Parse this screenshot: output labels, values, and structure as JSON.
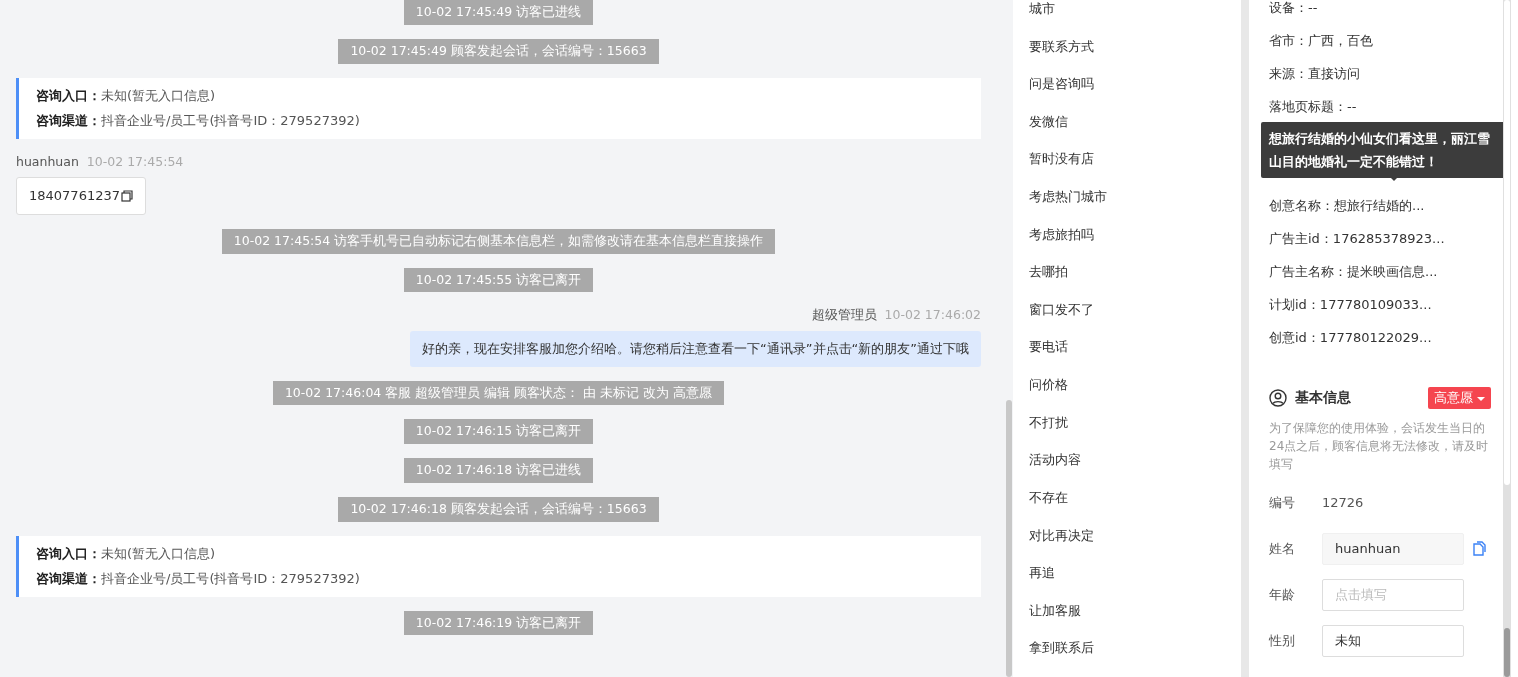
{
  "chat": [
    {
      "kind": "system",
      "text": "10-02 17:45:49 访客已进线"
    },
    {
      "kind": "system",
      "text": "10-02 17:45:49 顾客发起会话，会话编号：15663"
    },
    {
      "kind": "source",
      "lines": [
        {
          "label": "咨询入口：",
          "value": "未知(暂无入口信息)"
        },
        {
          "label": "咨询渠道：",
          "value": "抖音企业号/员工号(抖音号ID：279527392)"
        }
      ]
    },
    {
      "kind": "visitor",
      "name": "huanhuan",
      "time": "10-02 17:45:54",
      "text": "18407761237"
    },
    {
      "kind": "system",
      "text": "10-02 17:45:54 访客手机号已自动标记右侧基本信息栏，如需修改请在基本信息栏直接操作"
    },
    {
      "kind": "system",
      "text": "10-02 17:45:55 访客已离开"
    },
    {
      "kind": "agent",
      "name": "超级管理员",
      "time": "10-02 17:46:02",
      "text": "好的亲，现在安排客服加您介绍哈。请您稍后注意查看一下“通讯录”并点击“新的朋友”通过下哦"
    },
    {
      "kind": "system",
      "text": "10-02 17:46:04 客服 超级管理员 编辑 顾客状态： 由 未标记 改为 高意愿"
    },
    {
      "kind": "system",
      "text": "10-02 17:46:15 访客已离开"
    },
    {
      "kind": "system",
      "text": "10-02 17:46:18 访客已进线"
    },
    {
      "kind": "system",
      "text": "10-02 17:46:18 顾客发起会话，会话编号：15663"
    },
    {
      "kind": "source",
      "lines": [
        {
          "label": "咨询入口：",
          "value": "未知(暂无入口信息)"
        },
        {
          "label": "咨询渠道：",
          "value": "抖音企业号/员工号(抖音号ID：279527392)"
        }
      ]
    },
    {
      "kind": "system",
      "text": "10-02 17:46:19 访客已离开"
    }
  ],
  "tags": [
    "城市",
    "要联系方式",
    "问是咨询吗",
    "发微信",
    "暂时没有店",
    "考虑热门城市",
    "考虑旅拍吗",
    "去哪拍",
    "窗口发不了",
    "要电话",
    "问价格",
    "不打扰",
    "活动内容",
    "不存在",
    "对比再决定",
    "再追",
    "让加客服",
    "拿到联系后"
  ],
  "info_lines": [
    {
      "kind": "line",
      "text": "设备：--"
    },
    {
      "kind": "line",
      "text": "省市：广西，百色"
    },
    {
      "kind": "line",
      "text": "来源：直接访问"
    },
    {
      "kind": "line",
      "text": "落地页标题：--"
    },
    {
      "kind": "tooltip",
      "text": "想旅行结婚的小仙女们看这里，丽江雪山目的地婚礼一定不能错过！"
    },
    {
      "kind": "line",
      "text": "创意名称：想旅行结婚的..."
    },
    {
      "kind": "line",
      "text": "广告主id：176285378923..."
    },
    {
      "kind": "line",
      "text": "广告主名称：提米映画信息..."
    },
    {
      "kind": "line",
      "text": "计划id：177780109033..."
    },
    {
      "kind": "line",
      "text": "创意id：177780122029..."
    }
  ],
  "basic_info": {
    "title": "基本信息",
    "status": "高意愿",
    "note": "为了保障您的使用体验，会话发生当日的24点之后，顾客信息将无法修改，请及时填写",
    "fields": [
      {
        "kind": "text",
        "label": "编号",
        "value": "12726"
      },
      {
        "kind": "filled",
        "label": "姓名",
        "value": "huanhuan"
      },
      {
        "kind": "input",
        "label": "年龄",
        "placeholder": "点击填写"
      },
      {
        "kind": "select",
        "label": "性别",
        "value": "未知"
      }
    ]
  }
}
